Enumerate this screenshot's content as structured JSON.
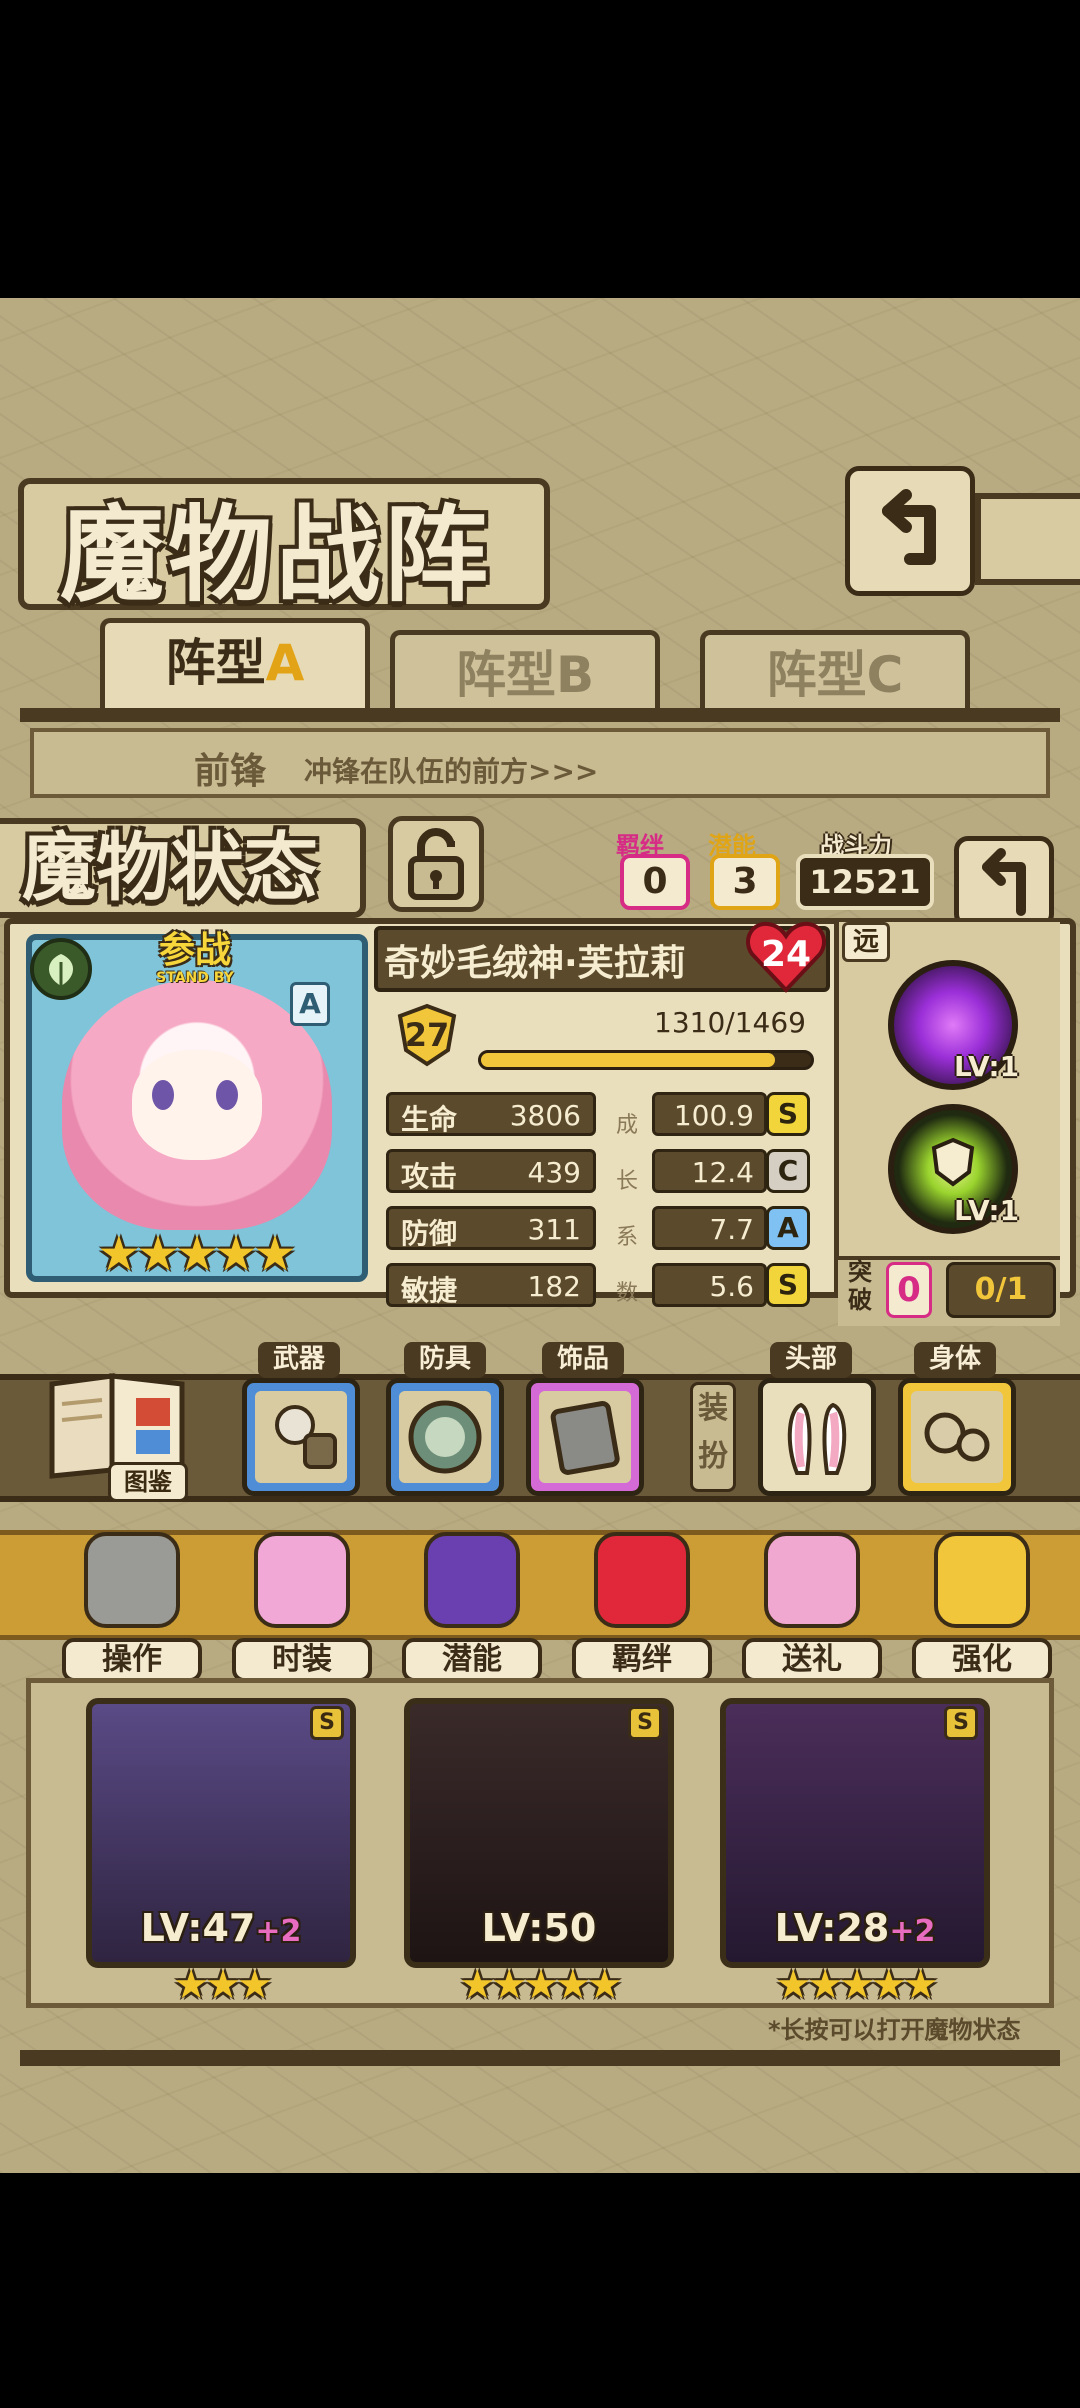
{
  "screen_title": "魔物战阵",
  "tabs": [
    {
      "prefix": "阵型",
      "letter": "A"
    },
    {
      "prefix": "阵型",
      "letter": "B"
    },
    {
      "prefix": "阵型",
      "letter": "C"
    }
  ],
  "formation_hint": {
    "row": "前锋",
    "desc": "冲锋在队伍的前方>>>"
  },
  "status_panel": {
    "title": "魔物状态",
    "bond": {
      "label": "羁绊",
      "value": "0"
    },
    "potential": {
      "label": "潜能",
      "value": "3"
    },
    "power": {
      "label": "战斗力",
      "value": "12521"
    },
    "range": "远"
  },
  "character": {
    "badge_main": "参战",
    "badge_sub": "STAND BY",
    "rank": "A",
    "name": "奇妙毛绒神·芙拉莉",
    "heart_count": "24",
    "level": "27",
    "exp_text": "1310/1469",
    "exp_progress": 0.892,
    "stars": "★★★★★"
  },
  "stats": [
    {
      "label": "生命",
      "value": "3806",
      "growth": "100.9",
      "grade": "S"
    },
    {
      "label": "攻击",
      "value": "439",
      "growth": "12.4",
      "grade": "C"
    },
    {
      "label": "防御",
      "value": "311",
      "growth": "7.7",
      "grade": "A"
    },
    {
      "label": "敏捷",
      "value": "182",
      "growth": "5.6",
      "grade": "S"
    }
  ],
  "growth_vertical": [
    "成",
    "长",
    "系",
    "数"
  ],
  "skills": [
    {
      "level": "LV:1",
      "color": "#9b2fd8"
    },
    {
      "level": "LV:1",
      "color": "#9ad42e"
    }
  ],
  "breakthrough": {
    "label_1": "突",
    "label_2": "破",
    "value": "0",
    "progress": "0/1"
  },
  "equipment": {
    "book_label": "图鉴",
    "weapon": "武器",
    "armor": "防具",
    "accessory": "饰品",
    "dress_label": [
      "装",
      "扮"
    ],
    "head": "头部",
    "body": "身体"
  },
  "actions": [
    "操作",
    "时装",
    "潜能",
    "羁绊",
    "送礼",
    "强化"
  ],
  "team_cards": [
    {
      "level": "LV:47",
      "bonus": "+2",
      "stars": "★★★",
      "rank": "S"
    },
    {
      "level": "LV:50",
      "bonus": "",
      "stars": "★★★★★",
      "rank": "S"
    },
    {
      "level": "LV:28",
      "bonus": "+2",
      "stars": "★★★★★",
      "rank": "S"
    }
  ],
  "footer_hint": "*长按可以打开魔物状态"
}
